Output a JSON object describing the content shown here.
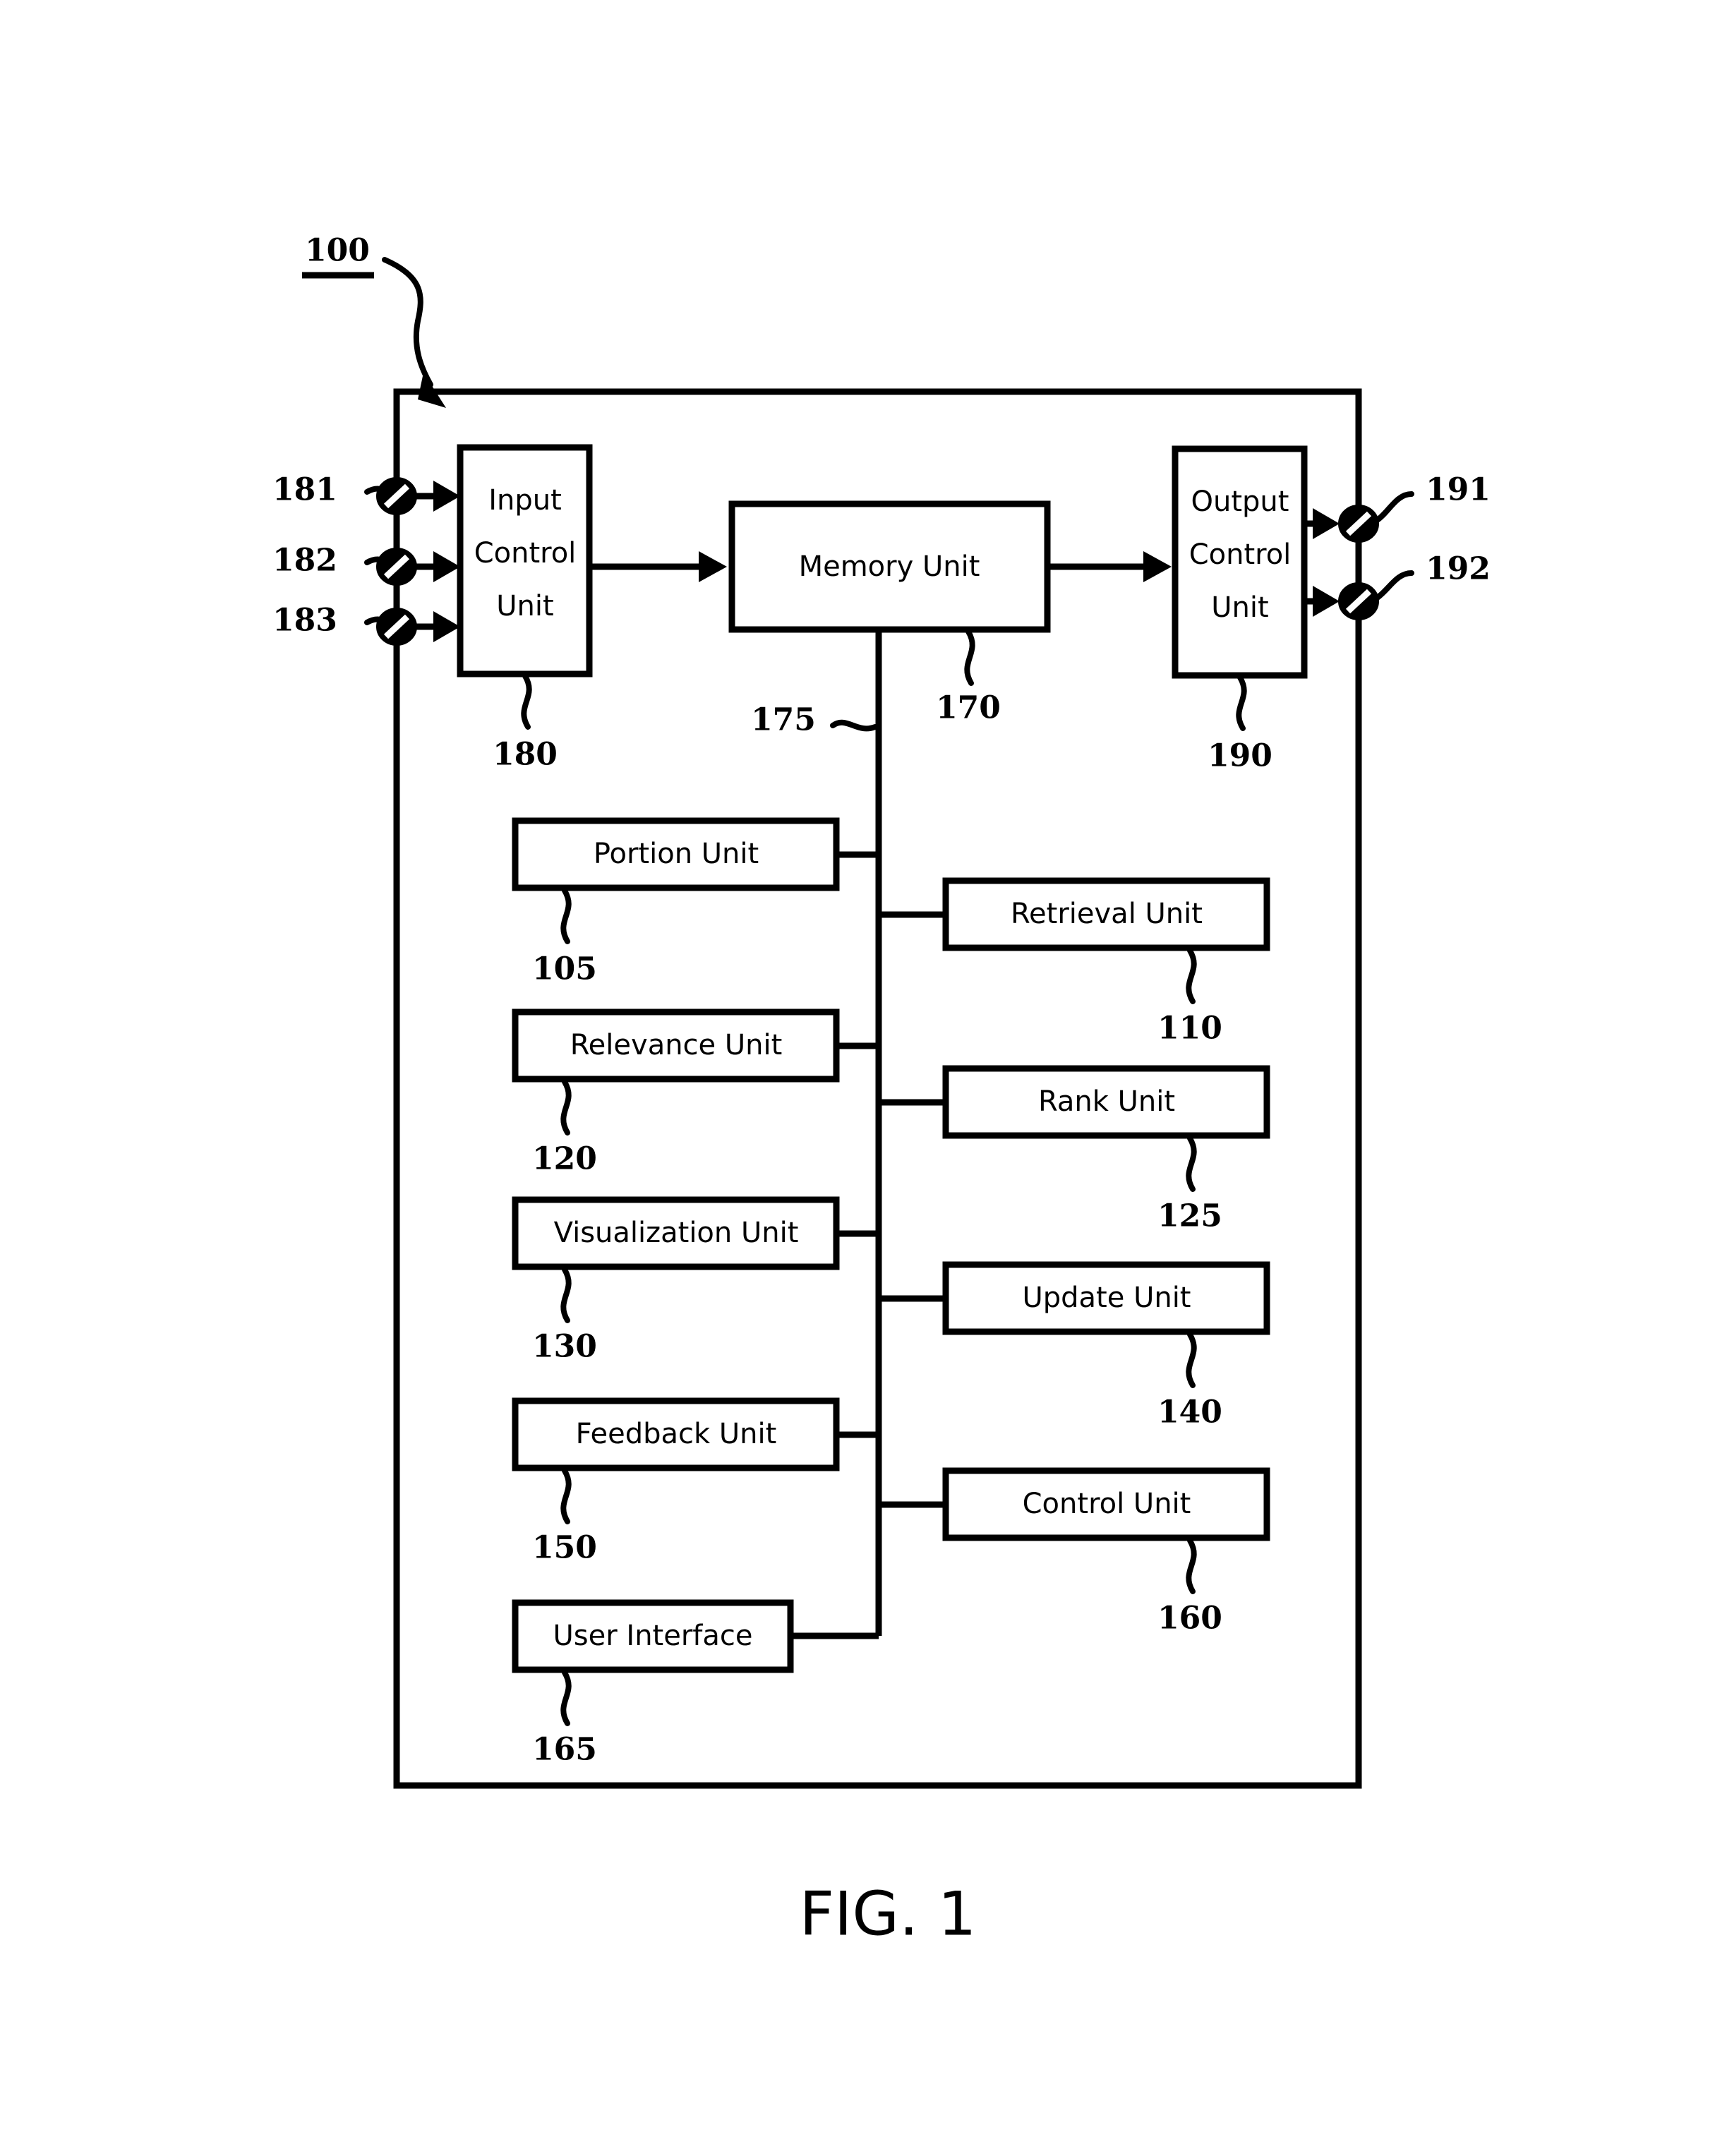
{
  "figure": {
    "caption": "FIG. 1",
    "system_ref": "100"
  },
  "boundary": {
    "name": "system-boundary",
    "ref": "100"
  },
  "top_row": {
    "input_control_unit": {
      "label_lines": [
        "Input",
        "Control",
        "Unit"
      ],
      "ref": "180"
    },
    "memory_unit": {
      "label": "Memory Unit",
      "ref": "170"
    },
    "output_control_unit": {
      "label_lines": [
        "Output",
        "Control",
        "Unit"
      ],
      "ref": "190"
    }
  },
  "bus": {
    "ref": "175"
  },
  "input_ports": [
    {
      "ref": "181"
    },
    {
      "ref": "182"
    },
    {
      "ref": "183"
    }
  ],
  "output_ports": [
    {
      "ref": "191"
    },
    {
      "ref": "192"
    }
  ],
  "left_units": [
    {
      "label": "Portion Unit",
      "ref": "105"
    },
    {
      "label": "Relevance Unit",
      "ref": "120"
    },
    {
      "label": "Visualization Unit",
      "ref": "130"
    },
    {
      "label": "Feedback Unit",
      "ref": "150"
    },
    {
      "label": "User Interface",
      "ref": "165"
    }
  ],
  "right_units": [
    {
      "label": "Retrieval Unit",
      "ref": "110"
    },
    {
      "label": "Rank Unit",
      "ref": "125"
    },
    {
      "label": "Update Unit",
      "ref": "140"
    },
    {
      "label": "Control Unit",
      "ref": "160"
    }
  ],
  "colors": {
    "ink": "#000000",
    "paper": "#ffffff"
  }
}
